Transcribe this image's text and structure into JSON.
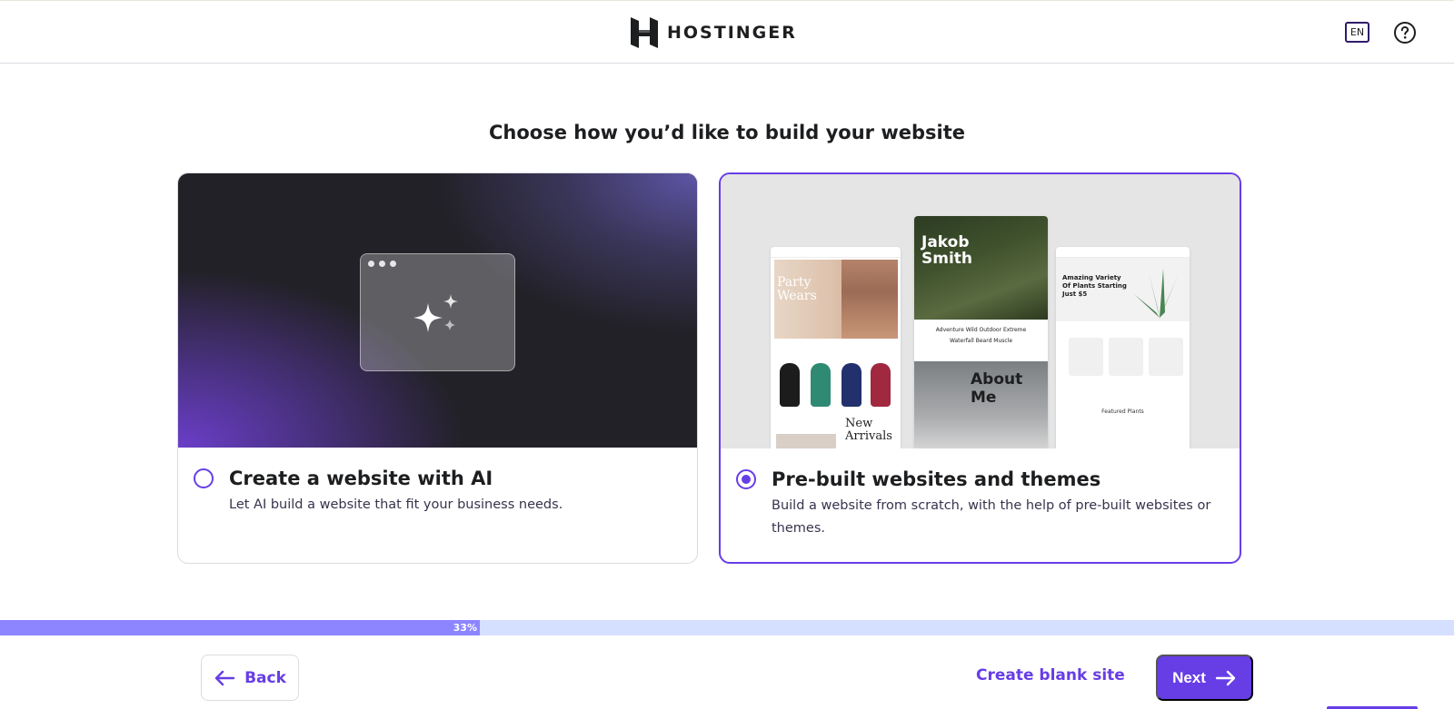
{
  "header": {
    "brand": "HOSTINGER",
    "language": "EN"
  },
  "page": {
    "heading": "Choose how you’d like to build your website"
  },
  "options": [
    {
      "title": "Create a website with AI",
      "description": "Let AI build a website that fit your business needs.",
      "selected": false
    },
    {
      "title": "Pre-built websites and themes",
      "description": "Build a website from scratch, with the help of pre-built websites or themes.",
      "selected": true
    }
  ],
  "preview": {
    "party_title": "Party Wears",
    "new_arrivals": "New Arrivals",
    "jakob_title": "Jakob Smith",
    "jakob_tags": "Adventure  Wild  Outdoor  Extreme",
    "jakob_tags2": "Waterfall  Beard  Muscle",
    "about_title": "About Me",
    "plants_title": "Amazing Variety Of Plants Starting Just $5",
    "featured": "Featured Plants"
  },
  "progress": {
    "label": "33%",
    "value": 0.33
  },
  "footer": {
    "back_label": "Back",
    "blank_label": "Create blank site",
    "next_label": "Next"
  },
  "colors": {
    "accent": "#673de6",
    "progress_fill": "#8c85ff",
    "progress_track": "#d5dfff"
  }
}
